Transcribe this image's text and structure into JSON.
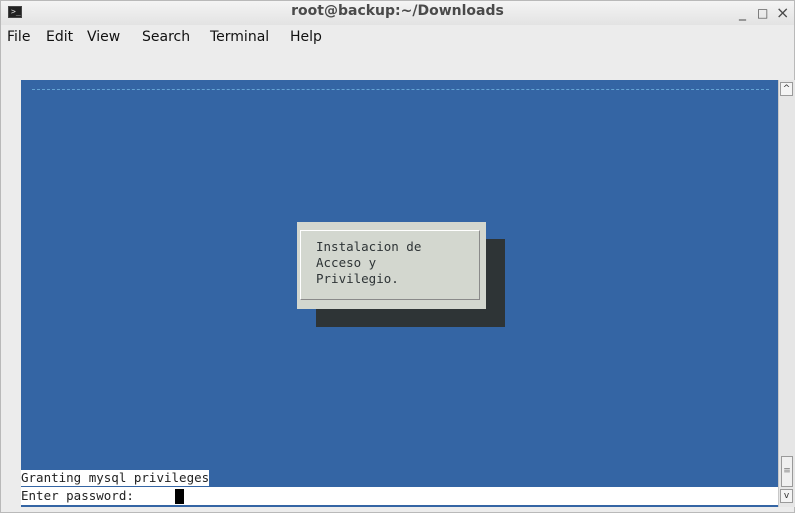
{
  "window": {
    "title": "root@backup:~/Downloads",
    "minimize": "_",
    "maximize": "□",
    "close": "×",
    "icon": "terminal-icon"
  },
  "menu": [
    "File",
    "Edit",
    "View",
    "Search",
    "Terminal",
    "Help"
  ],
  "terminal": {
    "background": "#3465a4",
    "dialog_text": "Instalacion de\nAcceso y\nPrivilegio.",
    "status_line": "Granting mysql privileges",
    "prompt": "Enter password: "
  },
  "scrollbar": {
    "up": "^",
    "down": "v",
    "thumb_grip": "≡"
  }
}
